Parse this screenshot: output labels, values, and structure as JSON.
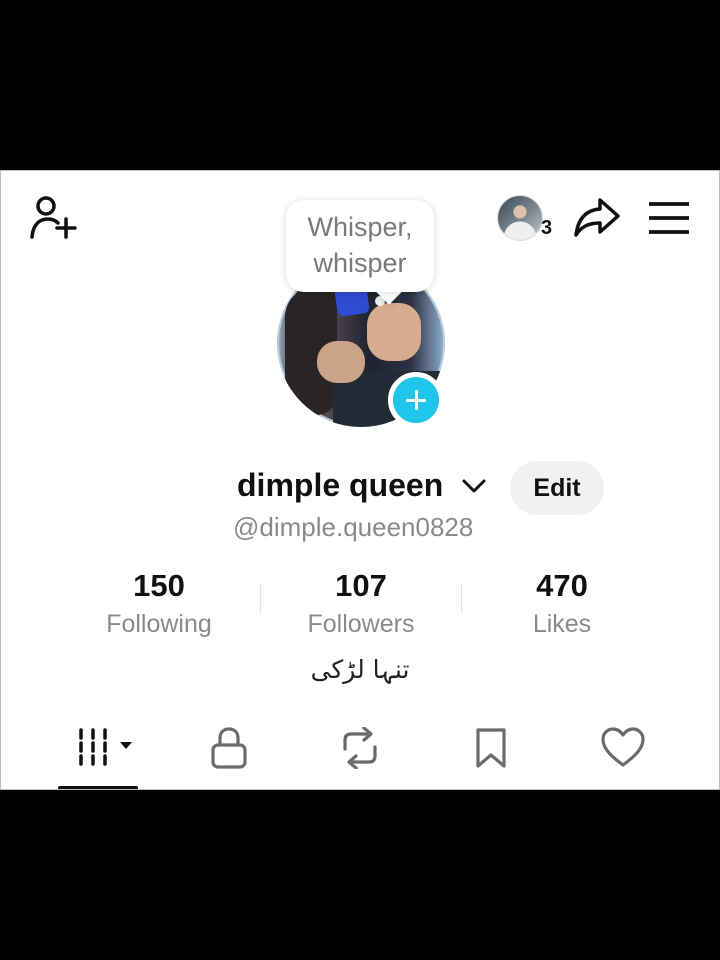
{
  "header": {
    "add_friend_icon": "person-plus-icon",
    "story_count": "3",
    "share_icon": "share-arrow-icon",
    "menu_icon": "hamburger-menu-icon"
  },
  "bubble": {
    "text_line1": "Whisper,",
    "text_line2": "whisper"
  },
  "profile": {
    "name": "dimple queen",
    "edit_label": "Edit",
    "handle": "@dimple.queen0828",
    "bio": "تنہا لڑکی",
    "accent_color": "#20c5ea"
  },
  "stats": [
    {
      "value": "150",
      "label": "Following"
    },
    {
      "value": "107",
      "label": "Followers"
    },
    {
      "value": "470",
      "label": "Likes"
    }
  ],
  "tabs": [
    {
      "icon": "videos-grid-icon",
      "selected": true
    },
    {
      "icon": "lock-icon",
      "selected": false
    },
    {
      "icon": "repost-icon",
      "selected": false
    },
    {
      "icon": "bookmark-icon",
      "selected": false
    },
    {
      "icon": "heart-icon",
      "selected": false
    }
  ]
}
